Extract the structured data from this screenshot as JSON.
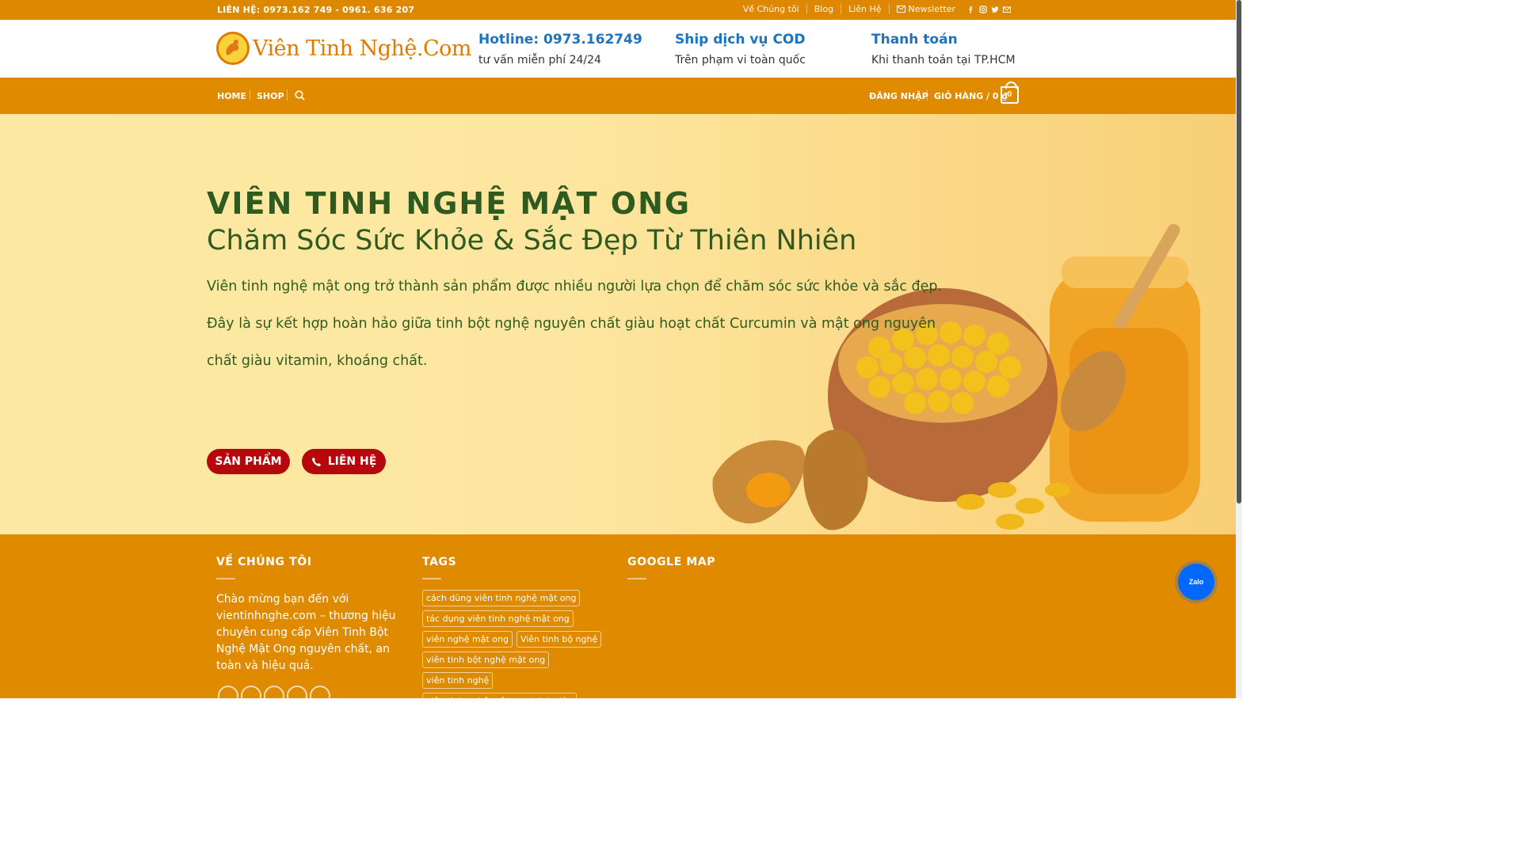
{
  "topbar": {
    "contact": "LIÊN HỆ: 0973.162 749 - 0961. 636 207",
    "links": [
      "Về Chúng tôi",
      "Blog",
      "Liên Hệ"
    ],
    "newsletter": "Newsletter",
    "social_icons": [
      "facebook-icon",
      "instagram-icon",
      "twitter-icon",
      "email-icon"
    ]
  },
  "header": {
    "logo_text": "Viên Tinh Nghệ.Com",
    "features": [
      {
        "title": "Hotline: 0973.162749",
        "subtitle": "tư vấn miễn phí 24/24"
      },
      {
        "title": "Ship dịch vụ COD",
        "subtitle": "Trên phạm vi toàn quốc"
      },
      {
        "title": "Thanh toán",
        "subtitle": "Khi thanh toán tại TP.HCM"
      }
    ]
  },
  "nav": {
    "home": "HOME",
    "shop": "SHOP",
    "login": "ĐĂNG NHẬP",
    "cart": "GIỎ HÀNG / 0 ₫",
    "cart_count": "0"
  },
  "hero": {
    "title": "VIÊN TINH NGHỆ MẬT ONG",
    "subtitle": "Chăm Sóc Sức Khỏe & Sắc Đẹp Từ Thiên Nhiên",
    "p1": "Viên tinh nghệ mật ong trở thành sản phẩm được nhiều người lựa chọn để chăm sóc sức khỏe và sắc đẹp.",
    "p2a": "Đây là sự kết hợp hoàn hảo giữa tinh bột nghệ nguyên chất giàu hoạt chất Curcumin và mật ong nguyên",
    "p2b": "chất giàu vitamin, khoáng chất.",
    "btn_products": "SẢN PHẨM",
    "btn_contact": "LIÊN HỆ"
  },
  "footer": {
    "about_heading": "VỀ CHÚNG TÔI",
    "about_text": "Chào mừng bạn đến với vientinhnghe.com – thương hiệu chuyên cung cấp Viên Tinh Bột Nghệ Mật Ong nguyên chất, an toàn và hiệu quả.",
    "tags_heading": "TAGS",
    "tags": [
      "cách dùng viên tinh nghệ mật ong",
      "tác dụng viên tinh nghệ mật ong",
      "viên nghệ mật ong",
      "Viên tinh bộ nghệ",
      "viên tinh bột nghệ mật ong",
      "viên tinh nghệ",
      "viên tinh nghệ mật ong trị dạ dày"
    ],
    "map_heading": "GOOGLE MAP"
  },
  "zalo": {
    "label": "Zalo"
  },
  "colors": {
    "orange": "#e08a00",
    "green": "#2f5a20",
    "red": "#b5070c",
    "blue": "#1e73be"
  }
}
